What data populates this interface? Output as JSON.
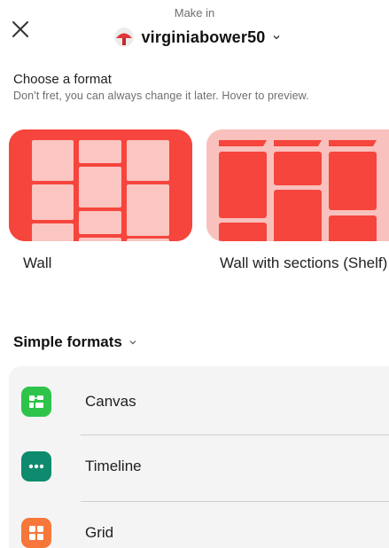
{
  "header": {
    "close_icon": "close-icon",
    "make_in_label": "Make in",
    "account_name": "virginiabower50",
    "avatar_icon": "avatar-umbrella-icon",
    "chevron_icon": "chevron-down-icon"
  },
  "choose": {
    "title": "Choose a format",
    "subtitle": "Don't fret, you can always change it later. Hover to preview."
  },
  "formats": [
    {
      "label": "Wall",
      "preview_icon": "wall-preview",
      "color": "#f5453d"
    },
    {
      "label": "Wall with sections (Shelf)",
      "preview_icon": "shelf-preview",
      "color": "#f9c1bd"
    }
  ],
  "simple_formats": {
    "title": "Simple formats",
    "items": [
      {
        "label": "Canvas",
        "icon": "canvas-icon",
        "color": "#2ec44a"
      },
      {
        "label": "Timeline",
        "icon": "timeline-icon",
        "color": "#0e8a6e"
      },
      {
        "label": "Grid",
        "icon": "grid-icon",
        "color": "#f7773a"
      }
    ]
  },
  "colors": {
    "accent_red": "#f5453d",
    "accent_pink": "#f9c1bd",
    "panel_bg": "#f4f4f4"
  }
}
